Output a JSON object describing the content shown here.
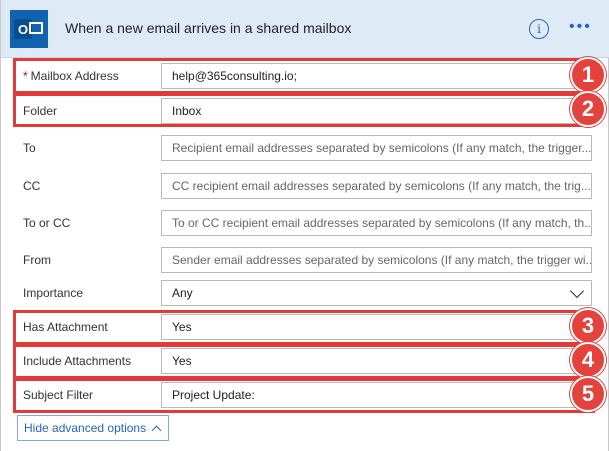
{
  "header": {
    "title": "When a new email arrives in a shared mailbox"
  },
  "fields": {
    "mailbox": {
      "label": "Mailbox Address",
      "required_mark": "*",
      "value": "help@365consulting.io;"
    },
    "folder": {
      "label": "Folder",
      "value": "Inbox"
    },
    "to": {
      "label": "To",
      "placeholder": "Recipient email addresses separated by semicolons (If any match, the trigger..."
    },
    "cc": {
      "label": "CC",
      "placeholder": "CC recipient email addresses separated by semicolons (If any match, the trig..."
    },
    "to_or_cc": {
      "label": "To or CC",
      "placeholder": "To or CC recipient email addresses separated by semicolons (If any match, th..."
    },
    "from": {
      "label": "From",
      "placeholder": "Sender email addresses separated by semicolons (If any match, the trigger wi..."
    },
    "importance": {
      "label": "Importance",
      "value": "Any"
    },
    "has_attachment": {
      "label": "Has Attachment",
      "value": "Yes"
    },
    "include_attachments": {
      "label": "Include Attachments",
      "value": "Yes"
    },
    "subject_filter": {
      "label": "Subject Filter",
      "value": "Project Update:"
    }
  },
  "annotations": [
    "1",
    "2",
    "3",
    "4",
    "5"
  ],
  "advanced_button": {
    "label": "Hide advanced options"
  },
  "colors": {
    "accent": "#2266c4",
    "highlight": "#e23b37",
    "header_bg": "#dfeaf7"
  }
}
